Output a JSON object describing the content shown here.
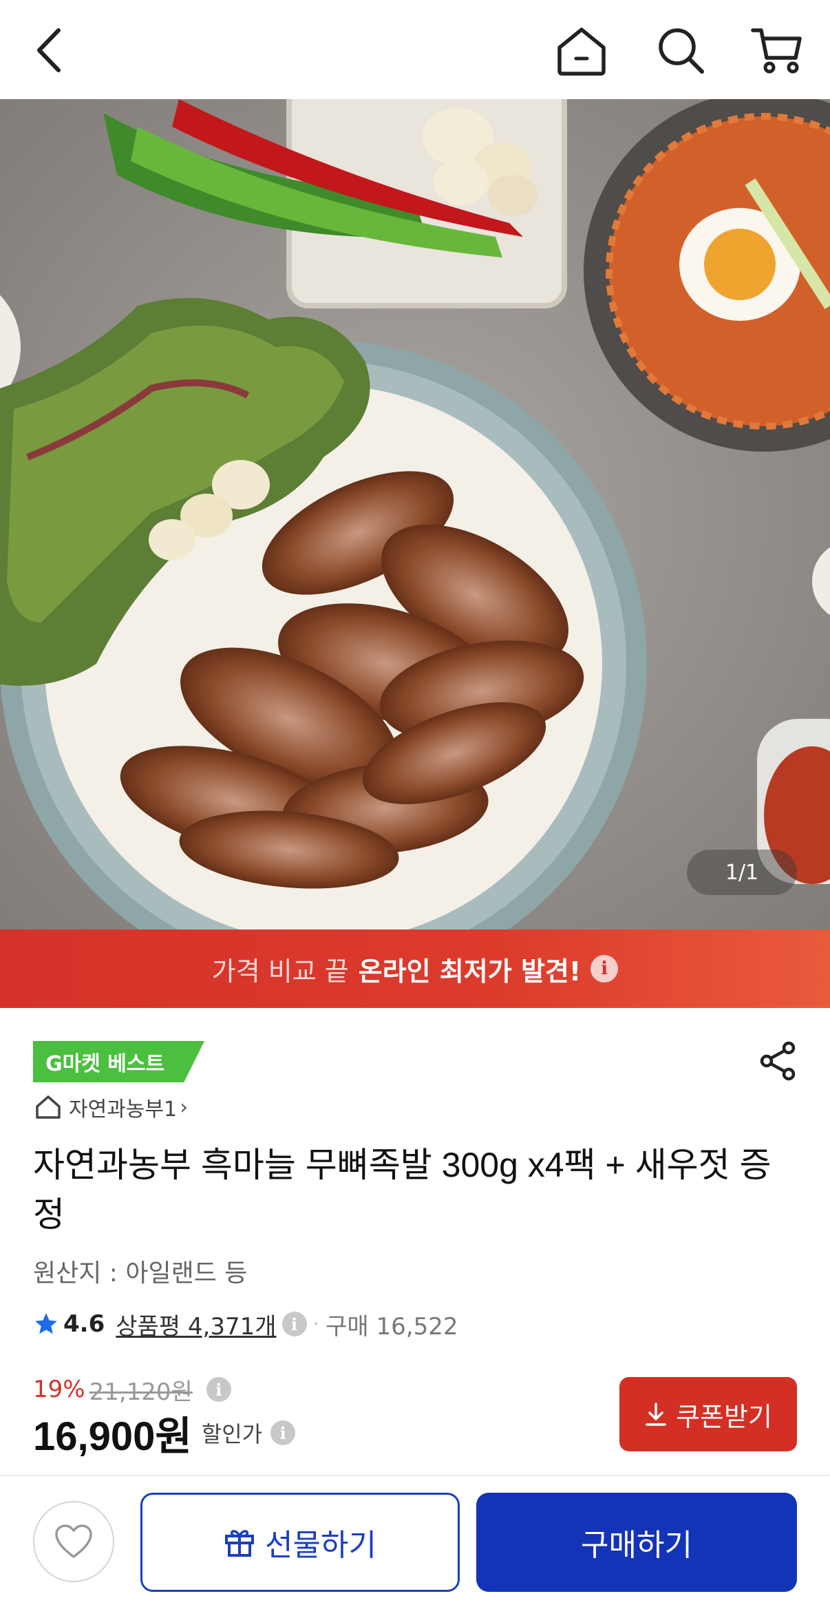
{
  "header": {
    "back_icon": "chevron-left-icon",
    "home_icon": "home-icon",
    "search_icon": "search-icon",
    "cart_icon": "cart-icon"
  },
  "hero": {
    "counter": "1/1"
  },
  "promo": {
    "light_text": "가격 비교 끝",
    "bold_text": "온라인 최저가 발견!",
    "info_icon": "i"
  },
  "product": {
    "badge": "G마켓 베스트",
    "seller": "자연과농부1",
    "title": "자연과농부 흑마늘 무뼈족발 300g x4팩 + 새우젓 증정",
    "origin": "원산지 : 아일랜드 등",
    "rating": "4.6",
    "reviews": "상품평 4,371개",
    "purchases": "구매 16,522"
  },
  "pricing": {
    "discount_pct": "19%",
    "original_price": "21,120원",
    "price": "16,900원",
    "price_label": "할인가",
    "coupon_label": "쿠폰받기"
  },
  "bottom": {
    "gift_label": "선물하기",
    "buy_label": "구매하기"
  },
  "colors": {
    "promo_red": "#d6322a",
    "badge_green": "#4bbf3f",
    "coupon_red": "#d42f24",
    "primary_blue": "#1434b7"
  }
}
